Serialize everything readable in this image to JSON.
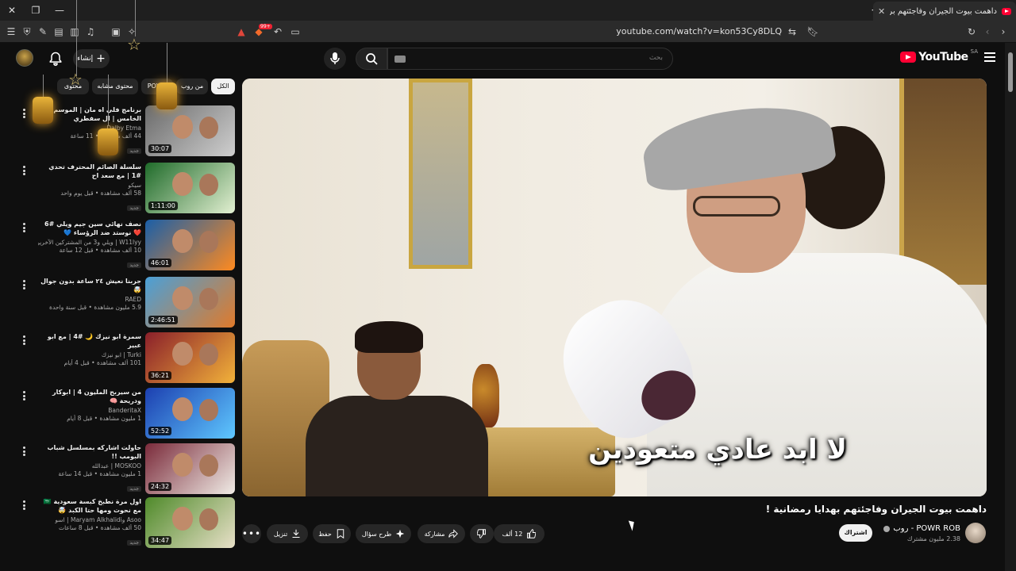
{
  "browser": {
    "tab_title": "داهمت بيوت الجيران وفاجئتهم بر",
    "url": "youtube.com/watch?v=kon53Cy8DLQ",
    "extension_badge": "99+"
  },
  "header": {
    "logo_text": "YouTube",
    "logo_region": "SA",
    "search_placeholder": "بحث",
    "create_label": "إنشاء"
  },
  "chips": [
    {
      "label": "الكل",
      "active": true
    },
    {
      "label": "من روب",
      "active": false
    },
    {
      "label": "POWR",
      "active": false
    },
    {
      "label": "محتوى مشابه",
      "active": false
    },
    {
      "label": "محتوى",
      "active": false
    }
  ],
  "player": {
    "subtitle": "لا ابد عادي متعودين"
  },
  "video": {
    "title": "داهمت بيوت الجيران وفاجئتهم بهدايا رمضانية !",
    "channel_name": "POWR ROB - روب",
    "subscribers": "2.38 مليون مشترك",
    "subscribe_label": "اشتراك",
    "likes": "12 ألف",
    "share_label": "مشاركة",
    "ask_label": "طرح سؤال",
    "save_label": "حفظ",
    "download_label": "تنزيل"
  },
  "sidebar": [
    {
      "title": "برنامج فلي اه مان | الموسم الخامس | ال سفطري",
      "channel": "Dalby Etma",
      "views": "44 ألف مشاهدة",
      "age": "11 ساعة",
      "badge": "جديد",
      "duration": "30:07",
      "thumb_colors": [
        "#6b6b6b",
        "#cfcfcf"
      ]
    },
    {
      "title": "سلسلة الصائم المحترف تحدي #1 | مع سعد اح",
      "channel": "سيكو",
      "views": "58 ألف مشاهدة",
      "age": "قبل يوم واحد",
      "badge": "جديد",
      "duration": "1:11:00",
      "thumb_colors": [
        "#1f6b2a",
        "#e3f0d2"
      ]
    },
    {
      "title": "نصف نهائي سين جيم ويلي #6 ❤️ نوستد ضد الرؤساء 💙",
      "channel": "W11lyy | ويلي و3 من المشتركين الآخرين",
      "views": "10 ألف مشاهدة",
      "age": "قبل 12 ساعة",
      "badge": "جديد",
      "duration": "46:01",
      "thumb_colors": [
        "#1a5fa8",
        "#ff8a1f"
      ]
    },
    {
      "title": "جربنا نعيش ٢٤ ساعة بدون جوال 🤯",
      "channel": "RAED",
      "views": "5.9 مليون مشاهدة",
      "age": "قبل سنة واحدة",
      "badge": "",
      "duration": "2:46:51",
      "thumb_colors": [
        "#4aa0d8",
        "#e07a2a"
      ]
    },
    {
      "title": "سمرة ابو نيزك 🌙 #4 | مع ابو عبير",
      "channel": "Turki | ابو نيزك",
      "views": "101 ألف مشاهدة",
      "age": "قبل 4 أيام",
      "badge": "",
      "duration": "36:21",
      "thumb_colors": [
        "#8a1f2a",
        "#f2b23a"
      ]
    },
    {
      "title": "من سيربح المليون 4 | ابوكار ودريحة 🧠",
      "channel": "BanderitaX",
      "views": "1 مليون مشاهدة",
      "age": "قبل 8 أيام",
      "badge": "",
      "duration": "52:52",
      "thumb_colors": [
        "#1c3fb0",
        "#5fc8ff"
      ]
    },
    {
      "title": "حاولت اشاركه بمسلسل شباب البومب !!",
      "channel": "MOSKOO | عبدالله",
      "views": "1 مليون مشاهدة",
      "age": "قبل 14 ساعة",
      "badge": "جديد",
      "duration": "24:32",
      "thumb_colors": [
        "#7a2a3a",
        "#f0ece6"
      ]
    },
    {
      "title": "اول مرة نطبخ كبسة سعودية 🇸🇦 مع نحوت ومها حتا الكبد 🤯",
      "channel": "Asoo وMaryam Alkhalidi | اسو",
      "views": "50 ألف مشاهدة",
      "age": "قبل 8 ساعات",
      "badge": "جديد",
      "duration": "34:47",
      "thumb_colors": [
        "#4f8a2a",
        "#e8e0c8"
      ]
    }
  ]
}
